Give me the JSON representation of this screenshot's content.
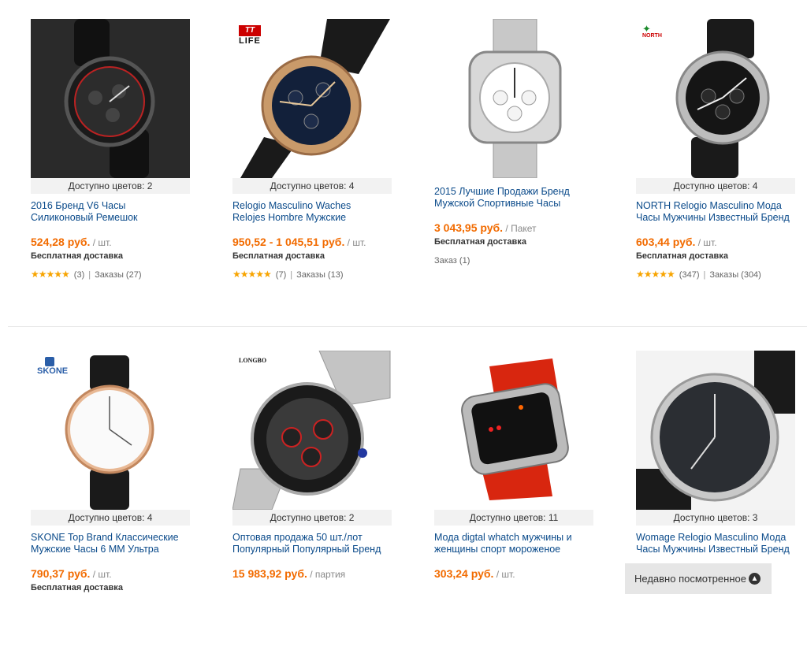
{
  "products_row1": [
    {
      "colors": "Доступно цветов: 2",
      "title1": "2016 Бренд V6 Часы",
      "title2": "Силиконовый Ремешок",
      "price": "524,28 руб.",
      "unit": " / шт.",
      "shipping": "Бесплатная доставка",
      "reviews": "(3)",
      "orders": "Заказы (27)",
      "stars": "★★★★★",
      "logo": ""
    },
    {
      "colors": "Доступно цветов: 4",
      "title1": "Relogio Masculino Waches",
      "title2": "Relojes Hombre Мужские",
      "price": "950,52 - 1 045,51 руб.",
      "unit": " / шт.",
      "shipping": "Бесплатная доставка",
      "reviews": "(7)",
      "orders": "Заказы (13)",
      "stars": "★★★★★",
      "logo": "LIFE"
    },
    {
      "colors": "",
      "title1": "2015 Лучшие Продажи Бренд",
      "title2": "Мужской Спортивные Часы",
      "price": "3 043,95 руб.",
      "unit": " / Пакет",
      "shipping": "Бесплатная доставка",
      "orders_only": "Заказ (1)",
      "logo": ""
    },
    {
      "colors": "Доступно цветов: 4",
      "title1": "NORTH Relogio Masculino Мода",
      "title2": "Часы Мужчины Известный Бренд",
      "price": "603,44 руб.",
      "unit": " / шт.",
      "shipping": "Бесплатная доставка",
      "reviews": "(347)",
      "orders": "Заказы (304)",
      "stars": "★★★★★",
      "logo": "NORTH"
    }
  ],
  "products_row2": [
    {
      "colors": "Доступно цветов: 4",
      "title1": "SKONE Top Brand Классические",
      "title2": "Мужские Часы 6 ММ Ультра",
      "price": "790,37 руб.",
      "unit": " / шт.",
      "shipping": "Бесплатная доставка",
      "logo": "SKONE"
    },
    {
      "colors": "Доступно цветов: 2",
      "title1": "Оптовая продажа 50 шт./лот",
      "title2": "Популярный Популярный Бренд",
      "price": "15 983,92 руб.",
      "unit": " / партия",
      "logo": "LONGBO"
    },
    {
      "colors": "Доступно цветов: 11",
      "title1": "Мода digtal whatch мужчины и",
      "title2": "женщины спорт мороженое",
      "price": "303,24 руб.",
      "unit": " / шт.",
      "logo": ""
    },
    {
      "colors": "Доступно цветов: 3",
      "title1": "Womage Relogio Masculino Мода",
      "title2": "Часы Мужчины Известный Бренд",
      "price": "",
      "unit": "",
      "logo": ""
    }
  ],
  "recent": {
    "label": "Недавно посмотренное",
    "icon": "chevron-up-icon"
  },
  "colors": {
    "price": "#f26b00",
    "title": "#0a4a8a",
    "stars": "#f7a400"
  }
}
